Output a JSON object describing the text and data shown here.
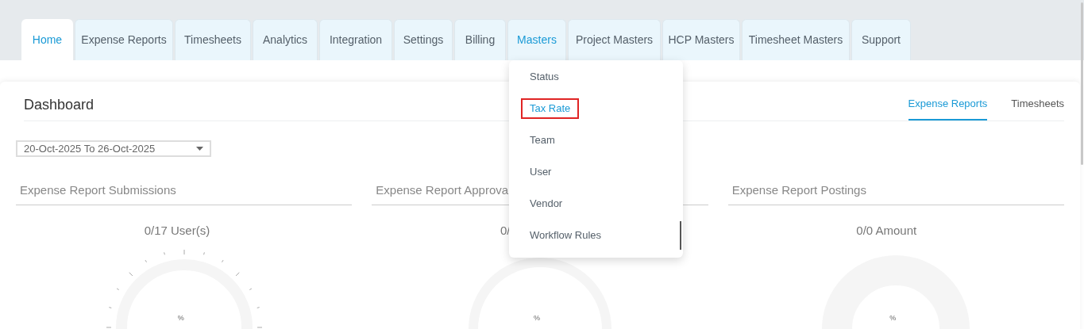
{
  "nav_tabs": [
    {
      "label": "Home",
      "selected": true,
      "open": false
    },
    {
      "label": "Expense Reports",
      "selected": false,
      "open": false
    },
    {
      "label": "Timesheets",
      "selected": false,
      "open": false
    },
    {
      "label": "Analytics",
      "selected": false,
      "open": false
    },
    {
      "label": "Integration",
      "selected": false,
      "open": false
    },
    {
      "label": "Settings",
      "selected": false,
      "open": false
    },
    {
      "label": "Billing",
      "selected": false,
      "open": false
    },
    {
      "label": "Masters",
      "selected": false,
      "open": true
    },
    {
      "label": "Project Masters",
      "selected": false,
      "open": false
    },
    {
      "label": "HCP Masters",
      "selected": false,
      "open": false
    },
    {
      "label": "Timesheet Masters",
      "selected": false,
      "open": false
    },
    {
      "label": "Support",
      "selected": false,
      "open": false
    }
  ],
  "masters_menu": [
    {
      "label": "Status",
      "highlighted": false
    },
    {
      "label": "Tax Rate",
      "highlighted": true
    },
    {
      "label": "Team",
      "highlighted": false
    },
    {
      "label": "User",
      "highlighted": false
    },
    {
      "label": "Vendor",
      "highlighted": false
    },
    {
      "label": "Workflow Rules",
      "highlighted": false
    }
  ],
  "dashboard": {
    "title": "Dashboard",
    "view_tabs": [
      {
        "label": "Expense Reports",
        "selected": true
      },
      {
        "label": "Timesheets",
        "selected": false
      }
    ],
    "date_range": "20-Oct-2025 To 26-Oct-2025",
    "panels": [
      {
        "title": "Expense Report Submissions",
        "reading": "0/17 User(s)",
        "gauge": {
          "kind": "ticked",
          "unit": "%"
        }
      },
      {
        "title": "Expense Report Approva",
        "reading": "0/",
        "gauge": {
          "kind": "ring",
          "unit": "%"
        }
      },
      {
        "title": "Expense Report Postings",
        "reading": "0/0 Amount",
        "gauge": {
          "kind": "donut",
          "unit": "%"
        }
      }
    ]
  }
}
